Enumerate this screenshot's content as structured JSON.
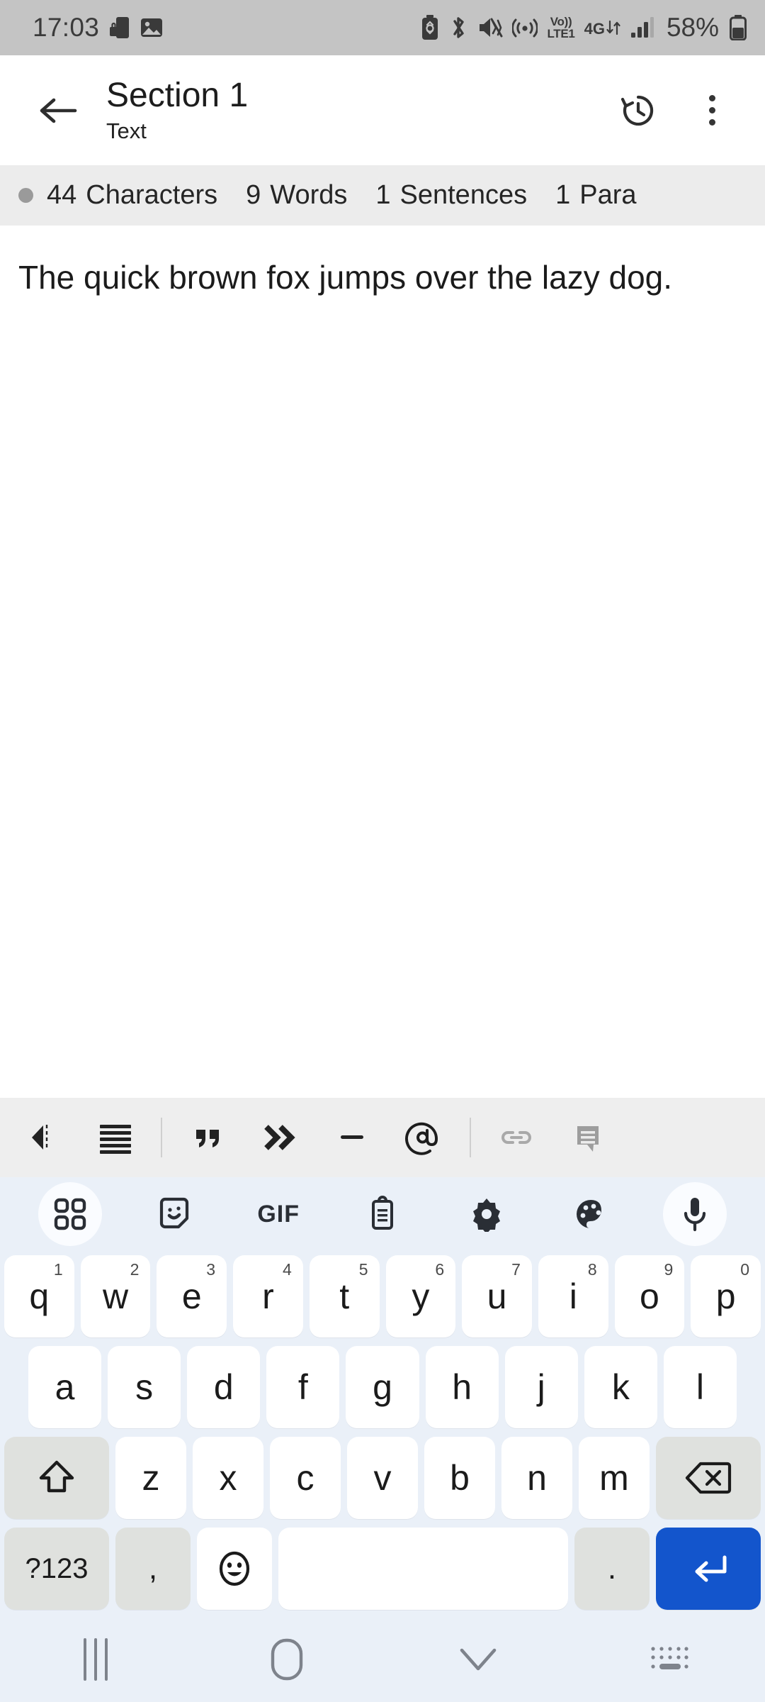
{
  "status_bar": {
    "time": "17:03",
    "battery_percent": "58%",
    "network_voice": "Vo))",
    "network_lte": "LTE1",
    "network_gen": "4G",
    "left_icons": [
      "phone-lock-icon",
      "image-icon"
    ],
    "right_icons": [
      "battery-saver-icon",
      "bluetooth-icon",
      "mute-vibrate-icon",
      "hotspot-icon",
      "volte-icon",
      "4g-data-icon",
      "signal-bars-icon",
      "battery-icon"
    ],
    "bg_color": "#c4c4c4"
  },
  "app_bar": {
    "back_label": "back-arrow",
    "title": "Section 1",
    "subtitle": "Text",
    "history_label": "history-icon",
    "overflow_label": "more-options"
  },
  "stats_bar": {
    "bg_color": "#ececec",
    "items": [
      {
        "value": "44",
        "label": "Characters"
      },
      {
        "value": "9",
        "label": "Words"
      },
      {
        "value": "1",
        "label": "Sentences"
      },
      {
        "value": "1",
        "label": "Para"
      }
    ]
  },
  "editor": {
    "text": "The quick brown fox jumps over the lazy dog."
  },
  "format_toolbar": {
    "bg_color": "#eeeeee",
    "items": [
      {
        "name": "collapse-toolbar-icon",
        "enabled": true
      },
      {
        "name": "align-justify-icon",
        "enabled": true
      },
      {
        "name": "separator",
        "enabled": false
      },
      {
        "name": "blockquote-icon",
        "enabled": true
      },
      {
        "name": "indent-icon",
        "enabled": true
      },
      {
        "name": "horizontal-rule-icon",
        "enabled": true
      },
      {
        "name": "mention-icon",
        "enabled": true
      },
      {
        "name": "separator",
        "enabled": false
      },
      {
        "name": "link-icon",
        "enabled": false
      },
      {
        "name": "comment-icon",
        "enabled": false
      }
    ]
  },
  "keyboard": {
    "bg_color": "#eaf0f8",
    "accent_color": "#1355cc",
    "toolbar": [
      {
        "name": "apps-grid-icon",
        "highlighted": true
      },
      {
        "name": "sticker-icon",
        "highlighted": false
      },
      {
        "name": "gif-icon",
        "label": "GIF",
        "highlighted": false
      },
      {
        "name": "clipboard-icon",
        "highlighted": false
      },
      {
        "name": "settings-gear-icon",
        "highlighted": false
      },
      {
        "name": "theme-palette-icon",
        "highlighted": false
      },
      {
        "name": "microphone-icon",
        "highlighted": true
      }
    ],
    "row1": [
      {
        "key": "q",
        "num": "1"
      },
      {
        "key": "w",
        "num": "2"
      },
      {
        "key": "e",
        "num": "3"
      },
      {
        "key": "r",
        "num": "4"
      },
      {
        "key": "t",
        "num": "5"
      },
      {
        "key": "y",
        "num": "6"
      },
      {
        "key": "u",
        "num": "7"
      },
      {
        "key": "i",
        "num": "8"
      },
      {
        "key": "o",
        "num": "9"
      },
      {
        "key": "p",
        "num": "0"
      }
    ],
    "row2": [
      {
        "key": "a"
      },
      {
        "key": "s"
      },
      {
        "key": "d"
      },
      {
        "key": "f"
      },
      {
        "key": "g"
      },
      {
        "key": "h"
      },
      {
        "key": "j"
      },
      {
        "key": "k"
      },
      {
        "key": "l"
      }
    ],
    "row3": {
      "shift": "shift-icon",
      "letters": [
        {
          "key": "z"
        },
        {
          "key": "x"
        },
        {
          "key": "c"
        },
        {
          "key": "v"
        },
        {
          "key": "b"
        },
        {
          "key": "n"
        },
        {
          "key": "m"
        }
      ],
      "backspace": "backspace-icon"
    },
    "row4": {
      "symbols": "?123",
      "comma": ",",
      "emoji": "emoji-icon",
      "space": "",
      "period": ".",
      "enter": "enter-icon"
    }
  },
  "nav_bar": {
    "bg_color": "#eaf0f8",
    "items": [
      {
        "name": "recents-button"
      },
      {
        "name": "home-button"
      },
      {
        "name": "hide-keyboard-button"
      },
      {
        "name": "keyboard-switcher-button"
      }
    ]
  }
}
